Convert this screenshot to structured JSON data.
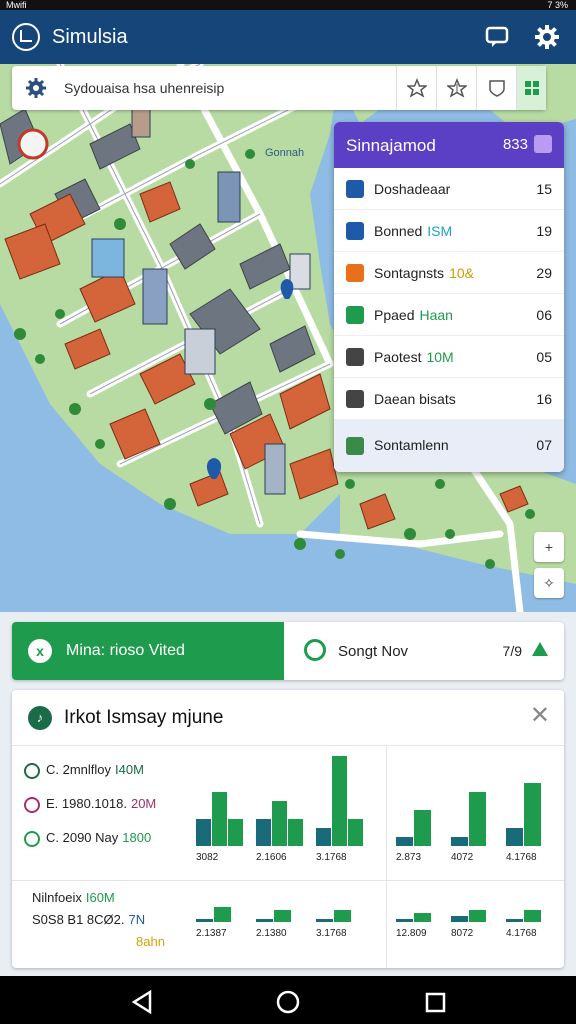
{
  "status_bar": {
    "left": "Mwifi",
    "right": "7 3%"
  },
  "app_bar": {
    "title": "Simulsia",
    "icons": [
      "logo-icon",
      "chat-icon",
      "settings-icon"
    ]
  },
  "search": {
    "text": "Sydouaisa hsa uhenreisip",
    "tools": [
      "star-outline-icon",
      "star-icon",
      "shield-icon",
      "grid-icon"
    ]
  },
  "map": {
    "water_label": "Gonnah"
  },
  "poi_panel": {
    "title": "Sinnajamod",
    "count": "833",
    "items": [
      {
        "label": "Doshadeaar",
        "highlight": "",
        "value": "15",
        "color": "#1e5aa8",
        "icon": "checkbox-icon"
      },
      {
        "label": "Bonned",
        "highlight": "ISM",
        "value": "19",
        "color": "#1e5aa8",
        "icon": "shield-icon"
      },
      {
        "label": "Sontagnsts",
        "highlight": "10&",
        "value": "29",
        "color": "#e8701a",
        "icon": "box-icon"
      },
      {
        "label": "Ppaed",
        "highlight": "Haan",
        "value": "06",
        "color": "#1e9b4d",
        "icon": "square-green-icon"
      },
      {
        "label": "Paotest",
        "highlight": "10M",
        "value": "05",
        "color": "#444444",
        "icon": "grid-icon"
      },
      {
        "label": "Daean bisats",
        "highlight": "",
        "value": "16",
        "color": "#444444",
        "icon": "document-icon"
      },
      {
        "label": "Sontamlenn",
        "highlight": "",
        "value": "07",
        "color": "#3a8a4a",
        "icon": "pin-icon"
      }
    ]
  },
  "map_buttons": [
    "+",
    "✧"
  ],
  "tabs": {
    "active_label": "Mina: rioso Vited",
    "active_icon": "x",
    "inactive_label": "Songt Nov",
    "inactive_number": "7/9"
  },
  "panel": {
    "title": "Irkot Ismsay mjune",
    "legend_top": [
      {
        "text": "C. 2mnlfloy",
        "accent": "I40M",
        "color": "#1a6b47"
      },
      {
        "text": "E. 1980.1018.",
        "accent": "20M",
        "color": "#a0306e"
      },
      {
        "text": "C. 2090 Nay",
        "accent": "1800",
        "color": "#1e9b4d"
      }
    ],
    "legend_bottom": [
      {
        "text": "Nilnfoeix",
        "accent": "I60M"
      },
      {
        "text": "S0S8 B1 8CØ2.",
        "accent": "7N"
      },
      {
        "text": "",
        "accent": "8ahn"
      }
    ]
  },
  "chart_data": [
    {
      "type": "bar",
      "categories": [
        "3082",
        "2.1606",
        "3.1768"
      ],
      "series": [
        {
          "values": [
            3,
            3,
            2
          ]
        },
        {
          "values": [
            6,
            5,
            10
          ]
        },
        {
          "values": [
            3,
            3,
            3
          ]
        }
      ]
    },
    {
      "type": "bar",
      "categories": [
        "2.873",
        "4072",
        "4.1768"
      ],
      "series": [
        {
          "values": [
            1,
            1,
            2
          ]
        },
        {
          "values": [
            4,
            6,
            7
          ]
        }
      ]
    },
    {
      "type": "bar",
      "categories": [
        "2.1387",
        "2.1380",
        "3.1768"
      ],
      "series": [
        {
          "values": [
            1,
            1,
            1
          ]
        },
        {
          "values": [
            5,
            4,
            4
          ]
        }
      ]
    },
    {
      "type": "bar",
      "categories": [
        "12.809",
        "8072",
        "4.1768"
      ],
      "series": [
        {
          "values": [
            1,
            2,
            1
          ]
        },
        {
          "values": [
            3,
            4,
            4
          ]
        }
      ]
    }
  ],
  "colors": {
    "primary": "#16457a",
    "accent": "#5b3fc4",
    "green": "#1e9b4d",
    "teal": "#1a6b7a"
  }
}
